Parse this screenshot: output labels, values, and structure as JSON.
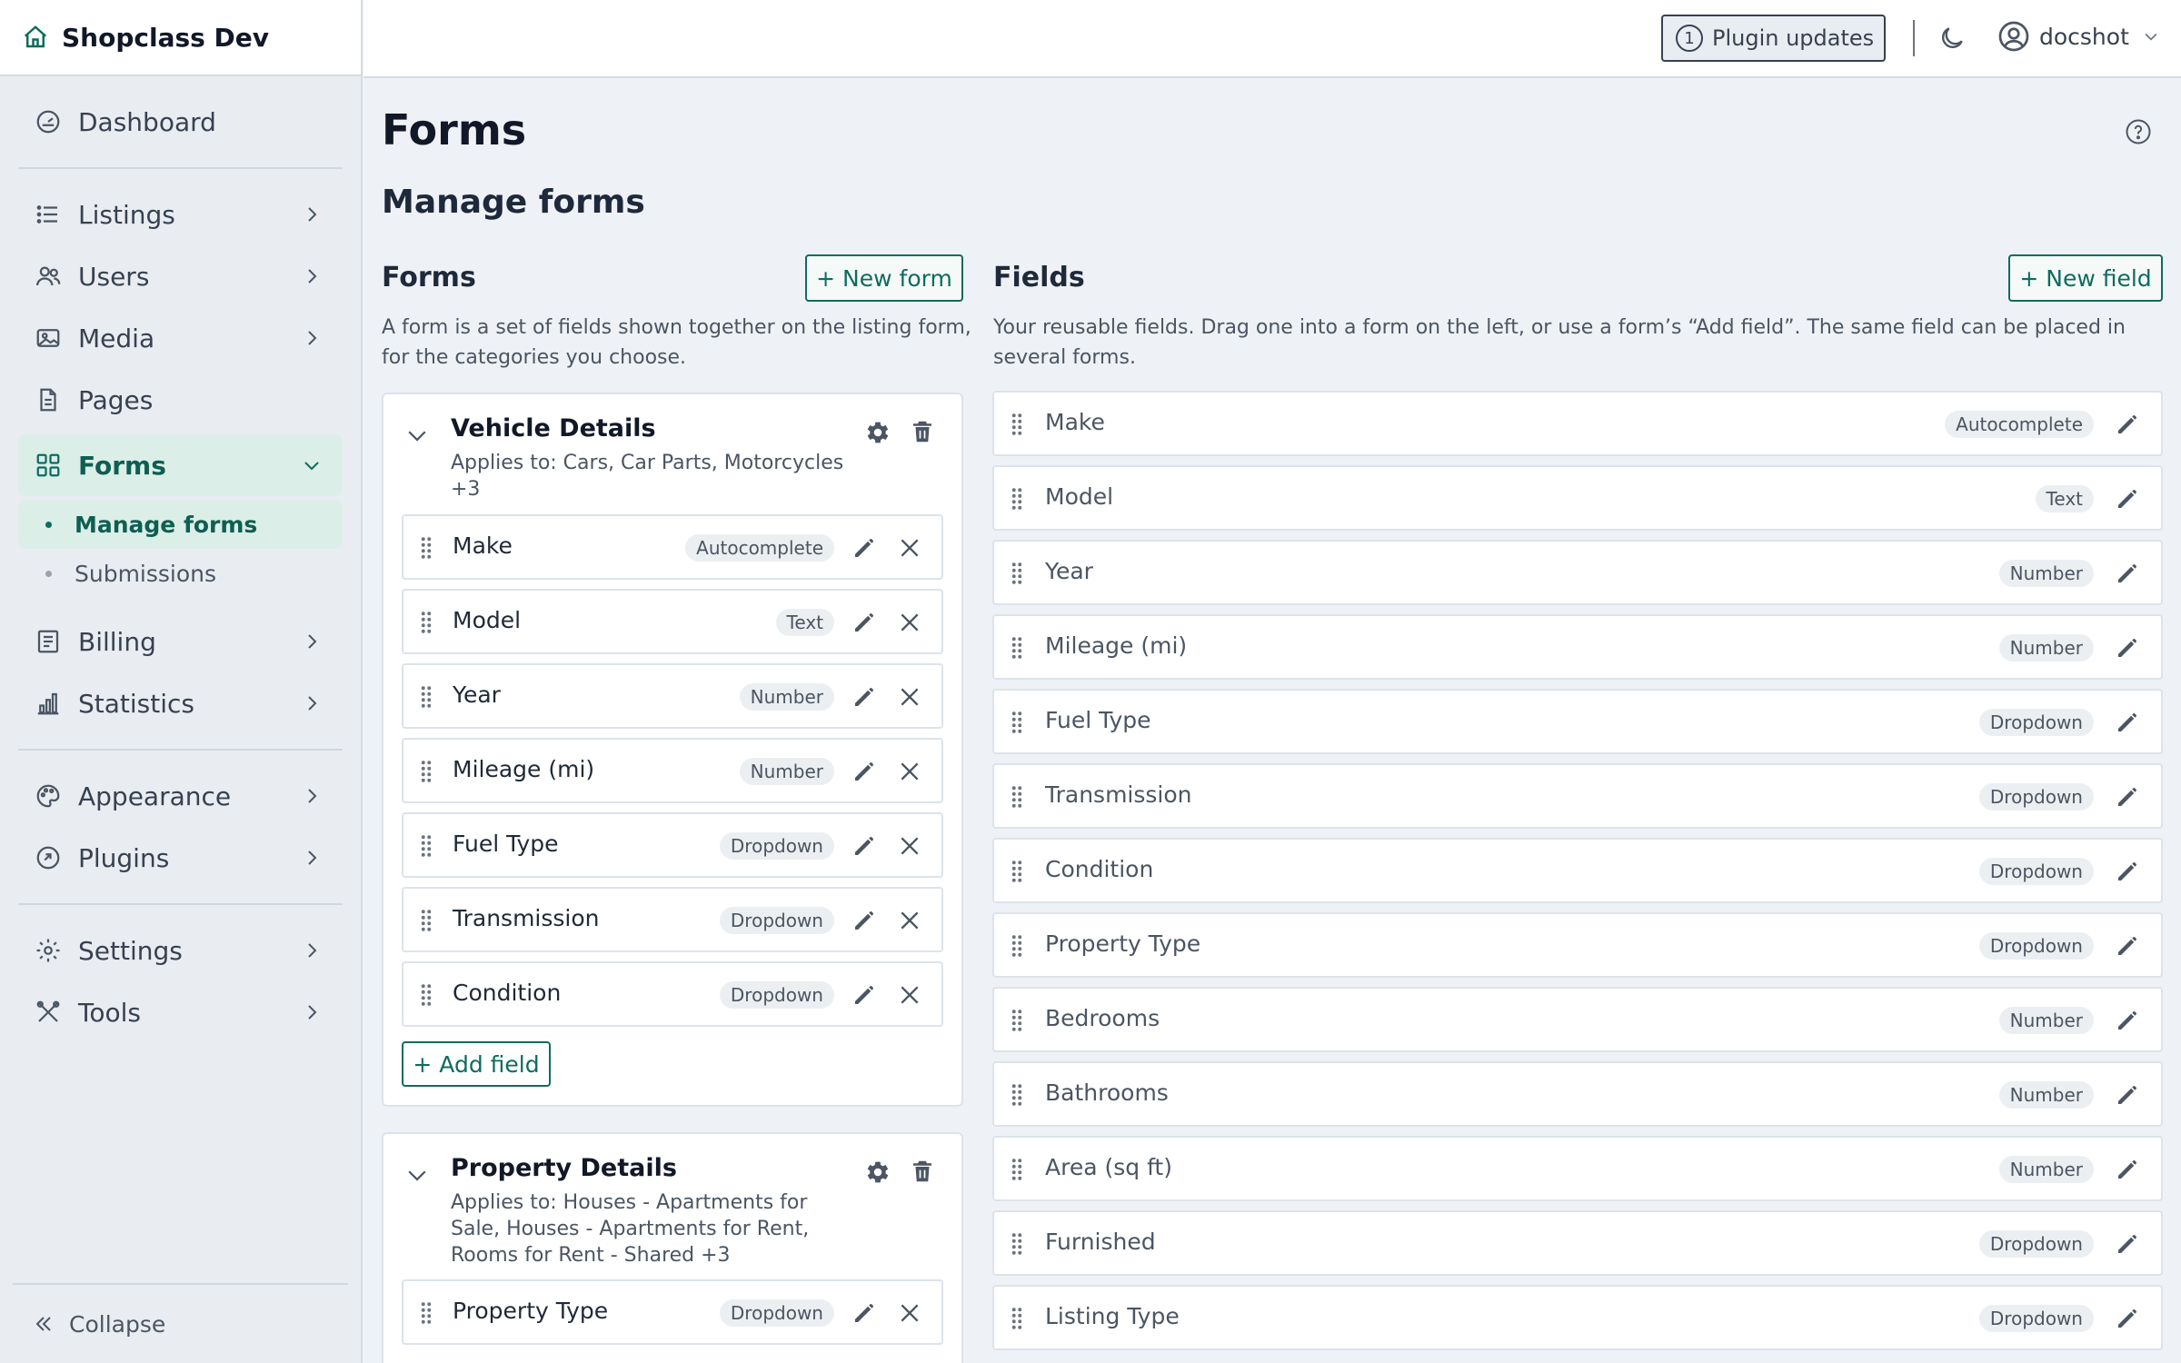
{
  "app": {
    "title": "Shopclass Dev"
  },
  "sidebar": {
    "items": [
      {
        "key": "dashboard",
        "label": "Dashboard"
      },
      {
        "key": "listings",
        "label": "Listings"
      },
      {
        "key": "users",
        "label": "Users"
      },
      {
        "key": "media",
        "label": "Media"
      },
      {
        "key": "pages",
        "label": "Pages"
      },
      {
        "key": "forms",
        "label": "Forms"
      },
      {
        "key": "billing",
        "label": "Billing"
      },
      {
        "key": "statistics",
        "label": "Statistics"
      },
      {
        "key": "appearance",
        "label": "Appearance"
      },
      {
        "key": "plugins",
        "label": "Plugins"
      },
      {
        "key": "settings",
        "label": "Settings"
      },
      {
        "key": "tools",
        "label": "Tools"
      }
    ],
    "forms_sub": [
      {
        "label": "Manage forms",
        "active": true
      },
      {
        "label": "Submissions",
        "active": false
      }
    ],
    "collapse_label": "Collapse"
  },
  "topbar": {
    "plugin_updates_count": "1",
    "plugin_updates_label": "Plugin updates",
    "username": "docshot"
  },
  "main": {
    "page_title": "Forms",
    "section_title": "Manage forms",
    "forms_column": {
      "heading": "Forms",
      "new_button": "+ New form",
      "description_line1": "A form is a set of fields shown together on the listing form,",
      "description_line2": "for the categories you choose."
    },
    "fields_column": {
      "heading": "Fields",
      "new_button": "+ New field",
      "description_line1": "Your reusable fields. Drag one into a form on the left, or use a form’s “Add field”. The same field can be placed in",
      "description_line2": "several forms."
    },
    "forms": [
      {
        "title": "Vehicle Details",
        "applies_line1": "Applies to: Cars, Car Parts, Motorcycles",
        "applies_line2": "+3",
        "fields": [
          {
            "name": "Make",
            "type": "Autocomplete"
          },
          {
            "name": "Model",
            "type": "Text"
          },
          {
            "name": "Year",
            "type": "Number"
          },
          {
            "name": "Mileage (mi)",
            "type": "Number"
          },
          {
            "name": "Fuel Type",
            "type": "Dropdown"
          },
          {
            "name": "Transmission",
            "type": "Dropdown"
          },
          {
            "name": "Condition",
            "type": "Dropdown"
          }
        ],
        "add_field_label": "+ Add field"
      },
      {
        "title": "Property Details",
        "applies_line1": "Applies to: Houses - Apartments for",
        "applies_line2": "Sale, Houses - Apartments for Rent,",
        "applies_line3": "Rooms for Rent - Shared +3",
        "fields": [
          {
            "name": "Property Type",
            "type": "Dropdown"
          }
        ]
      }
    ],
    "fields": [
      {
        "name": "Make",
        "type": "Autocomplete"
      },
      {
        "name": "Model",
        "type": "Text"
      },
      {
        "name": "Year",
        "type": "Number"
      },
      {
        "name": "Mileage (mi)",
        "type": "Number"
      },
      {
        "name": "Fuel Type",
        "type": "Dropdown"
      },
      {
        "name": "Transmission",
        "type": "Dropdown"
      },
      {
        "name": "Condition",
        "type": "Dropdown"
      },
      {
        "name": "Property Type",
        "type": "Dropdown"
      },
      {
        "name": "Bedrooms",
        "type": "Number"
      },
      {
        "name": "Bathrooms",
        "type": "Number"
      },
      {
        "name": "Area (sq ft)",
        "type": "Number"
      },
      {
        "name": "Furnished",
        "type": "Dropdown"
      },
      {
        "name": "Listing Type",
        "type": "Dropdown"
      }
    ]
  },
  "colors": {
    "accent": "#0f6b5e",
    "active_bg": "#dbeee8",
    "page_bg": "#eef2f6"
  }
}
